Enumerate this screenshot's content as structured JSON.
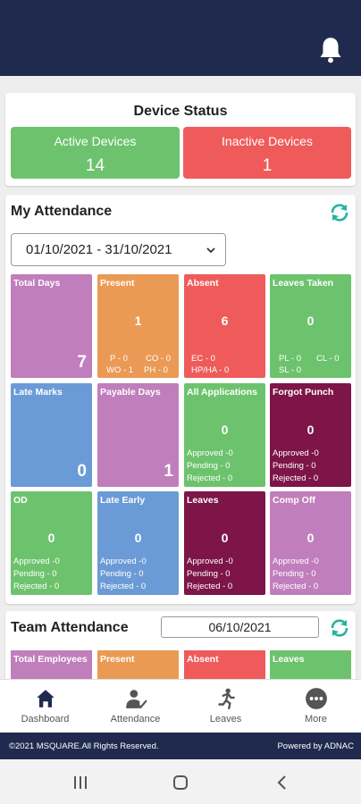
{
  "header": {
    "bell_icon": "bell-icon"
  },
  "device_status": {
    "title": "Device Status",
    "active_label": "Active Devices",
    "active_value": "14",
    "inactive_label": "Inactive Devices",
    "inactive_value": "1"
  },
  "my_attendance": {
    "title": "My Attendance",
    "date_range": "01/10/2021 - 31/10/2021",
    "tiles": {
      "total_days": {
        "label": "Total Days",
        "value": "7"
      },
      "present": {
        "label": "Present",
        "value": "1",
        "p": "P - 0",
        "co": "CO - 0",
        "wo": "WO - 1",
        "ph": "PH - 0"
      },
      "absent": {
        "label": "Absent",
        "value": "6",
        "ec": "EC - 0",
        "hp": "HP/HA - 0"
      },
      "leaves_taken": {
        "label": "Leaves Taken",
        "value": "0",
        "pl": "PL - 0",
        "cl": "CL - 0",
        "sl": "SL - 0"
      },
      "late_marks": {
        "label": "Late Marks",
        "value": "0"
      },
      "payable_days": {
        "label": "Payable Days",
        "value": "1"
      },
      "all_applications": {
        "label": "All Applications",
        "value": "0",
        "approved": "Approved -0",
        "pending": "Pending - 0",
        "rejected": "Rejected - 0"
      },
      "forgot_punch": {
        "label": "Forgot Punch",
        "value": "0",
        "approved": "Approved -0",
        "pending": "Pending - 0",
        "rejected": "Rejected - 0"
      },
      "od": {
        "label": "OD",
        "value": "0",
        "approved": "Approved -0",
        "pending": "Pending - 0",
        "rejected": "Rejected - 0"
      },
      "late_early": {
        "label": "Late Early",
        "value": "0",
        "approved": "Approved -0",
        "pending": "Pending - 0",
        "rejected": "Rejected - 0"
      },
      "leaves": {
        "label": "Leaves",
        "value": "0",
        "approved": "Approved -0",
        "pending": "Pending - 0",
        "rejected": "Rejected - 0"
      },
      "comp_off": {
        "label": "Comp Off",
        "value": "0",
        "approved": "Approved -0",
        "pending": "Pending - 0",
        "rejected": "Rejected - 0"
      }
    }
  },
  "team_attendance": {
    "title": "Team Attendance",
    "date": "06/10/2021",
    "tiles": [
      "Total Employees",
      "Present",
      "Absent",
      "Leaves"
    ]
  },
  "bottom_nav": [
    {
      "label": "Dashboard",
      "icon": "home-icon"
    },
    {
      "label": "Attendance",
      "icon": "attendance-icon"
    },
    {
      "label": "Leaves",
      "icon": "running-person-icon"
    },
    {
      "label": "More",
      "icon": "more-icon"
    }
  ],
  "footer": {
    "copyright": "©2021 MSQUARE.All Rights Reserved.",
    "powered": "Powered by ADNAC"
  },
  "colors": {
    "header": "#1f2a4e",
    "green": "#6dc36d",
    "red": "#ef5b5b",
    "purple": "#c07ebc",
    "orange": "#ea9a55",
    "blue": "#6b9bd6",
    "maroon": "#7d1548",
    "accent": "#26b5a0"
  }
}
